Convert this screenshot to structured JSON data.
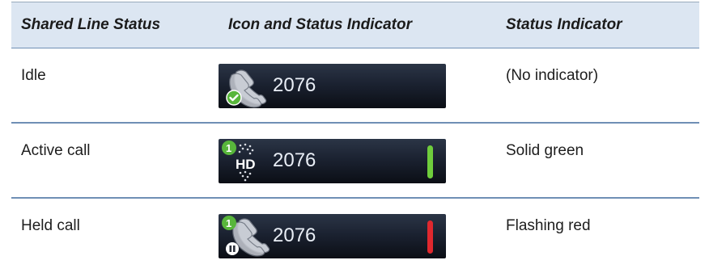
{
  "headers": {
    "col1": "Shared Line Status",
    "col2": "Icon and Status Indicator",
    "col3": "Status Indicator"
  },
  "rows": [
    {
      "status": "Idle",
      "line_number": "2076",
      "icon": "phone-handset-check-icon",
      "indicator": "(No indicator)",
      "bar_color": ""
    },
    {
      "status": "Active call",
      "line_number": "2076",
      "icon": "hd-audio-icon",
      "badge": "1",
      "indicator": "Solid green",
      "bar_color": "#6fcd3c"
    },
    {
      "status": "Held call",
      "line_number": "2076",
      "icon": "phone-handset-hold-icon",
      "badge": "1",
      "indicator": "Flashing red",
      "bar_color": "#e0282e"
    }
  ]
}
